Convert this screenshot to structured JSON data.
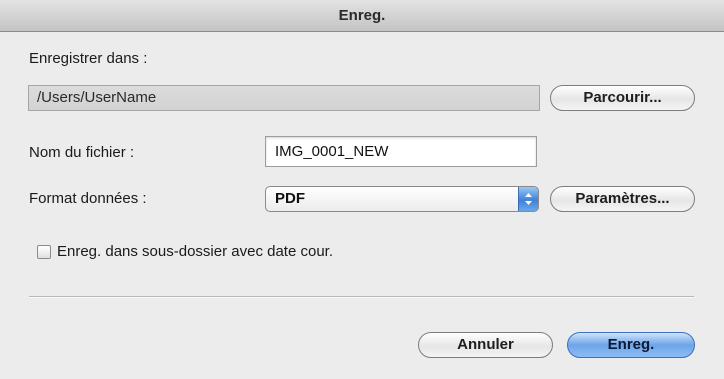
{
  "window": {
    "title": "Enreg."
  },
  "location": {
    "label": "Enregistrer dans :",
    "path": "/Users/UserName",
    "browse_button": "Parcourir..."
  },
  "filename": {
    "label": "Nom du fichier :",
    "value": "IMG_0001_NEW"
  },
  "format": {
    "label": "Format données :",
    "selected": "PDF",
    "settings_button": "Paramètres..."
  },
  "subfolder_option": {
    "label": "Enreg. dans sous-dossier avec date cour.",
    "checked": false
  },
  "footer": {
    "cancel_button": "Annuler",
    "save_button": "Enreg."
  },
  "colors": {
    "default_button": "#6ea5ea",
    "window_background": "#ececec"
  }
}
